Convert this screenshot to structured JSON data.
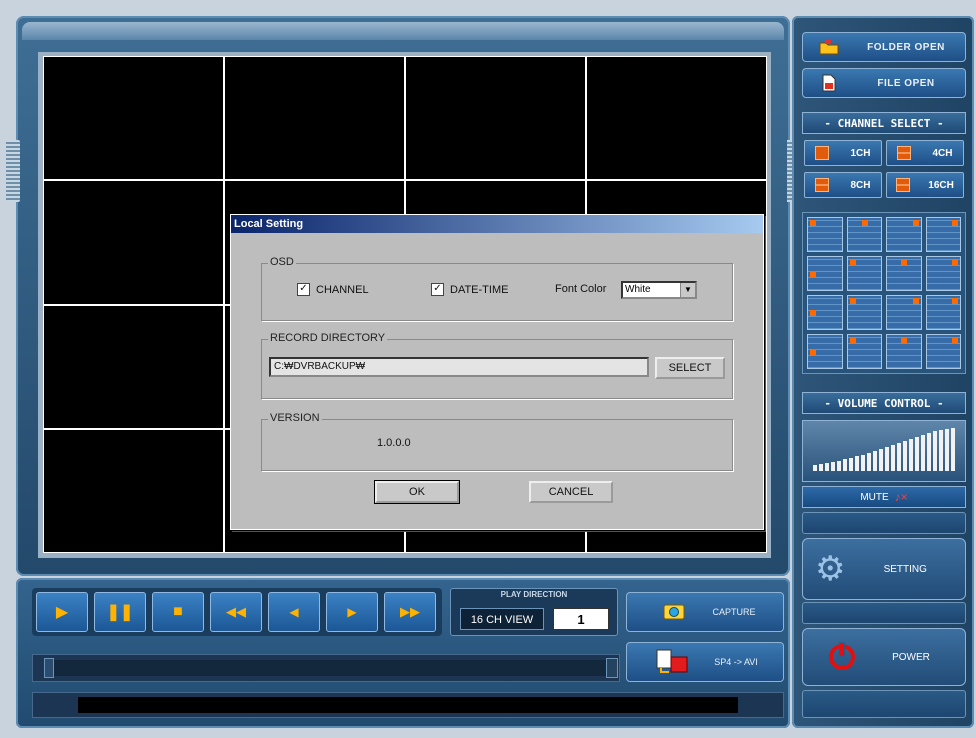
{
  "dialog": {
    "title": "Local Setting",
    "osd": {
      "legend": "OSD",
      "channel_label": "CHANNEL",
      "channel_checked": true,
      "datetime_label": "DATE-TIME",
      "datetime_checked": true,
      "font_color_label": "Font Color",
      "font_color_value": "White"
    },
    "record": {
      "legend": "RECORD DIRECTORY",
      "path": "C:₩DVRBACKUP₩",
      "select_label": "SELECT"
    },
    "version": {
      "legend": "VERSION",
      "value": "1.0.0.0"
    },
    "ok_label": "OK",
    "cancel_label": "CANCEL"
  },
  "right_panel": {
    "folder_open": "FOLDER OPEN",
    "file_open": "FILE OPEN",
    "channel_select_title": "- CHANNEL SELECT -",
    "channels": [
      "1CH",
      "4CH",
      "8CH",
      "16CH"
    ],
    "volume_title": "- VOLUME CONTROL -",
    "mute_label": "MUTE",
    "setting_label": "SETTING",
    "power_label": "POWER"
  },
  "playback": {
    "play_direction_title": "PLAY DIRECTION",
    "view_label": "16 CH VIEW",
    "view_number": "1",
    "capture_label": "CAPTURE",
    "convert_label": "SP4 -> AVI"
  },
  "colors": {
    "accent_orange": "#ffb200",
    "power_red": "#e01010"
  }
}
